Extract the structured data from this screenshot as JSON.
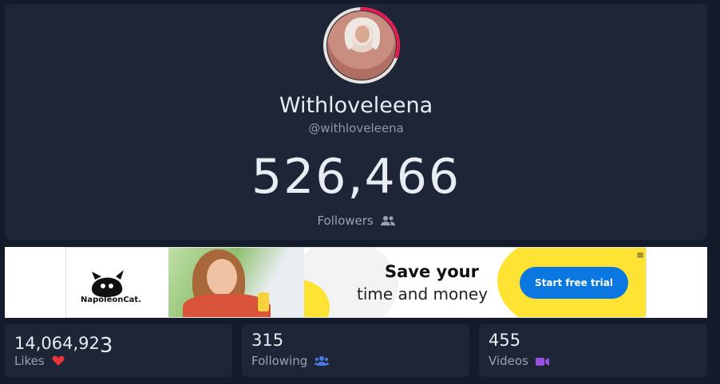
{
  "profile": {
    "display_name": "Withloveleena",
    "handle": "@withloveleena",
    "followers_count": "526,466",
    "followers_label": "Followers",
    "avatar_progress": 0.3
  },
  "ad": {
    "brand": "NapoleonCat.",
    "headline": "Save your",
    "subline": "time and money",
    "cta": "Start free trial",
    "menu_glyph": "≡"
  },
  "stats": [
    {
      "value_main": "14,064,92",
      "value_tail": "3",
      "label": "Likes",
      "icon": "heart-icon",
      "icon_color": "#e8323c"
    },
    {
      "value_main": "315",
      "value_tail": "",
      "label": "Following",
      "icon": "users-icon",
      "icon_color": "#4b7be5"
    },
    {
      "value_main": "455",
      "value_tail": "",
      "label": "Videos",
      "icon": "video-icon",
      "icon_color": "#9b4fe0"
    }
  ],
  "colors": {
    "background": "#141b2a",
    "card": "#1d2536",
    "accent_ring": "#e8194f",
    "cta": "#0a78e0",
    "ad_yellow": "#ffe333"
  }
}
